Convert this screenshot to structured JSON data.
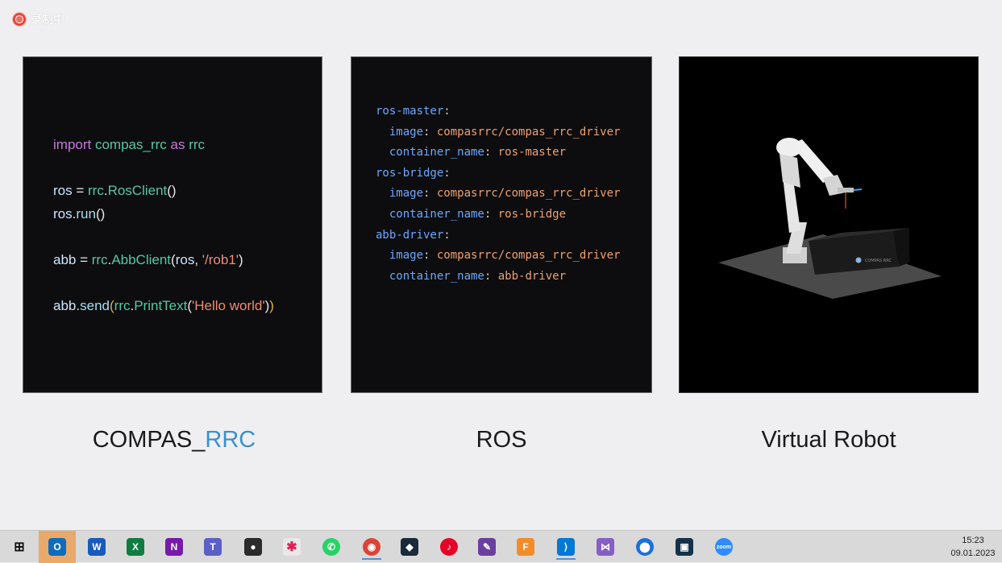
{
  "recording": {
    "label": "录制中"
  },
  "code_panel": {
    "lines": [
      [
        [
          "kw",
          "import"
        ],
        [
          "op",
          " "
        ],
        [
          "mod",
          "compas_rrc"
        ],
        [
          "op",
          " "
        ],
        [
          "kw",
          "as"
        ],
        [
          "op",
          " "
        ],
        [
          "mod",
          "rrc"
        ]
      ],
      [],
      [
        [
          "var",
          "ros"
        ],
        [
          "op",
          " = "
        ],
        [
          "mod",
          "rrc"
        ],
        [
          "op",
          "."
        ],
        [
          "mod",
          "RosClient"
        ],
        [
          "par1",
          "()"
        ]
      ],
      [
        [
          "var",
          "ros"
        ],
        [
          "op",
          "."
        ],
        [
          "fn",
          "run"
        ],
        [
          "par1",
          "()"
        ]
      ],
      [],
      [
        [
          "var",
          "abb"
        ],
        [
          "op",
          " = "
        ],
        [
          "mod",
          "rrc"
        ],
        [
          "op",
          "."
        ],
        [
          "mod",
          "AbbClient"
        ],
        [
          "par1",
          "("
        ],
        [
          "var",
          "ros"
        ],
        [
          "op",
          ", "
        ],
        [
          "str",
          "'/rob1'"
        ],
        [
          "par1",
          ")"
        ]
      ],
      [],
      [
        [
          "var",
          "abb"
        ],
        [
          "op",
          "."
        ],
        [
          "fn",
          "send"
        ],
        [
          "par2",
          "("
        ],
        [
          "mod",
          "rrc"
        ],
        [
          "op",
          "."
        ],
        [
          "mod",
          "PrintText"
        ],
        [
          "par1",
          "("
        ],
        [
          "str",
          "'Hello world'"
        ],
        [
          "par1",
          ")"
        ],
        [
          "par2",
          ")"
        ]
      ]
    ]
  },
  "ros_panel": {
    "lines": [
      [
        [
          "ykey",
          "ros-master"
        ],
        [
          "ycol",
          ":"
        ]
      ],
      [
        [
          "ycol",
          "  "
        ],
        [
          "ykey",
          "image"
        ],
        [
          "ycol",
          ": "
        ],
        [
          "yval",
          "compasrrc/compas_rrc_driver"
        ]
      ],
      [
        [
          "ycol",
          "  "
        ],
        [
          "ykey",
          "container_name"
        ],
        [
          "ycol",
          ": "
        ],
        [
          "yval",
          "ros-master"
        ]
      ],
      [],
      [
        [
          "ykey",
          "ros-bridge"
        ],
        [
          "ycol",
          ":"
        ]
      ],
      [
        [
          "ycol",
          "  "
        ],
        [
          "ykey",
          "image"
        ],
        [
          "ycol",
          ": "
        ],
        [
          "yval",
          "compasrrc/compas_rrc_driver"
        ]
      ],
      [
        [
          "ycol",
          "  "
        ],
        [
          "ykey",
          "container_name"
        ],
        [
          "ycol",
          ": "
        ],
        [
          "yval",
          "ros-bridge"
        ]
      ],
      [],
      [
        [
          "ykey",
          "abb-driver"
        ],
        [
          "ycol",
          ":"
        ]
      ],
      [
        [
          "ycol",
          "  "
        ],
        [
          "ykey",
          "image"
        ],
        [
          "ycol",
          ": "
        ],
        [
          "yval",
          "compasrrc/compas_rrc_driver"
        ]
      ],
      [
        [
          "ycol",
          "  "
        ],
        [
          "ykey",
          "container_name"
        ],
        [
          "ycol",
          ": "
        ],
        [
          "yval",
          "abb-driver"
        ]
      ]
    ]
  },
  "captions": {
    "compas_prefix": "COMPAS_",
    "compas_accent": "RRC",
    "ros": "ROS",
    "robot": "Virtual Robot"
  },
  "robot_panel": {
    "box_label": "COMPAS RRC"
  },
  "taskbar": {
    "apps": [
      {
        "name": "windows-start-icon",
        "color": "#1a1a1a",
        "glyph": "⊞"
      },
      {
        "name": "outlook-icon",
        "color": "#0f6cbd",
        "glyph": "O",
        "highlight": true
      },
      {
        "name": "word-icon",
        "color": "#185abd",
        "glyph": "W"
      },
      {
        "name": "excel-icon",
        "color": "#107c41",
        "glyph": "X"
      },
      {
        "name": "onenote-icon",
        "color": "#7719aa",
        "glyph": "N"
      },
      {
        "name": "teams-icon",
        "color": "#5b5fc7",
        "glyph": "T"
      },
      {
        "name": "chat-bubble-icon",
        "color": "#2b2b2b",
        "glyph": "●"
      },
      {
        "name": "slack-icon",
        "color": "#e8e8e8",
        "glyph": "✱"
      },
      {
        "name": "whatsapp-icon",
        "color": "#25d366",
        "glyph": "✆"
      },
      {
        "name": "chrome-icon",
        "color": "#db4437",
        "glyph": "◉",
        "active": true
      },
      {
        "name": "app-cube-icon",
        "color": "#1b2a3a",
        "glyph": "◆"
      },
      {
        "name": "netease-music-icon",
        "color": "#e60026",
        "glyph": "♪"
      },
      {
        "name": "pencil-app-icon",
        "color": "#6b3fa0",
        "glyph": "✎"
      },
      {
        "name": "fusion-360-icon",
        "color": "#f28c28",
        "glyph": "F"
      },
      {
        "name": "vscode-icon",
        "color": "#0078d4",
        "glyph": "⟩",
        "active": true
      },
      {
        "name": "visual-studio-icon",
        "color": "#865fc5",
        "glyph": "⋈"
      },
      {
        "name": "location-pin-icon",
        "color": "#1e6fd9",
        "glyph": "⬤"
      },
      {
        "name": "screen-app-icon",
        "color": "#16324a",
        "glyph": "▣"
      },
      {
        "name": "zoom-icon",
        "color": "#2d8cff",
        "glyph": "zoom"
      }
    ],
    "time": "15:23",
    "date": "09.01.2023"
  }
}
